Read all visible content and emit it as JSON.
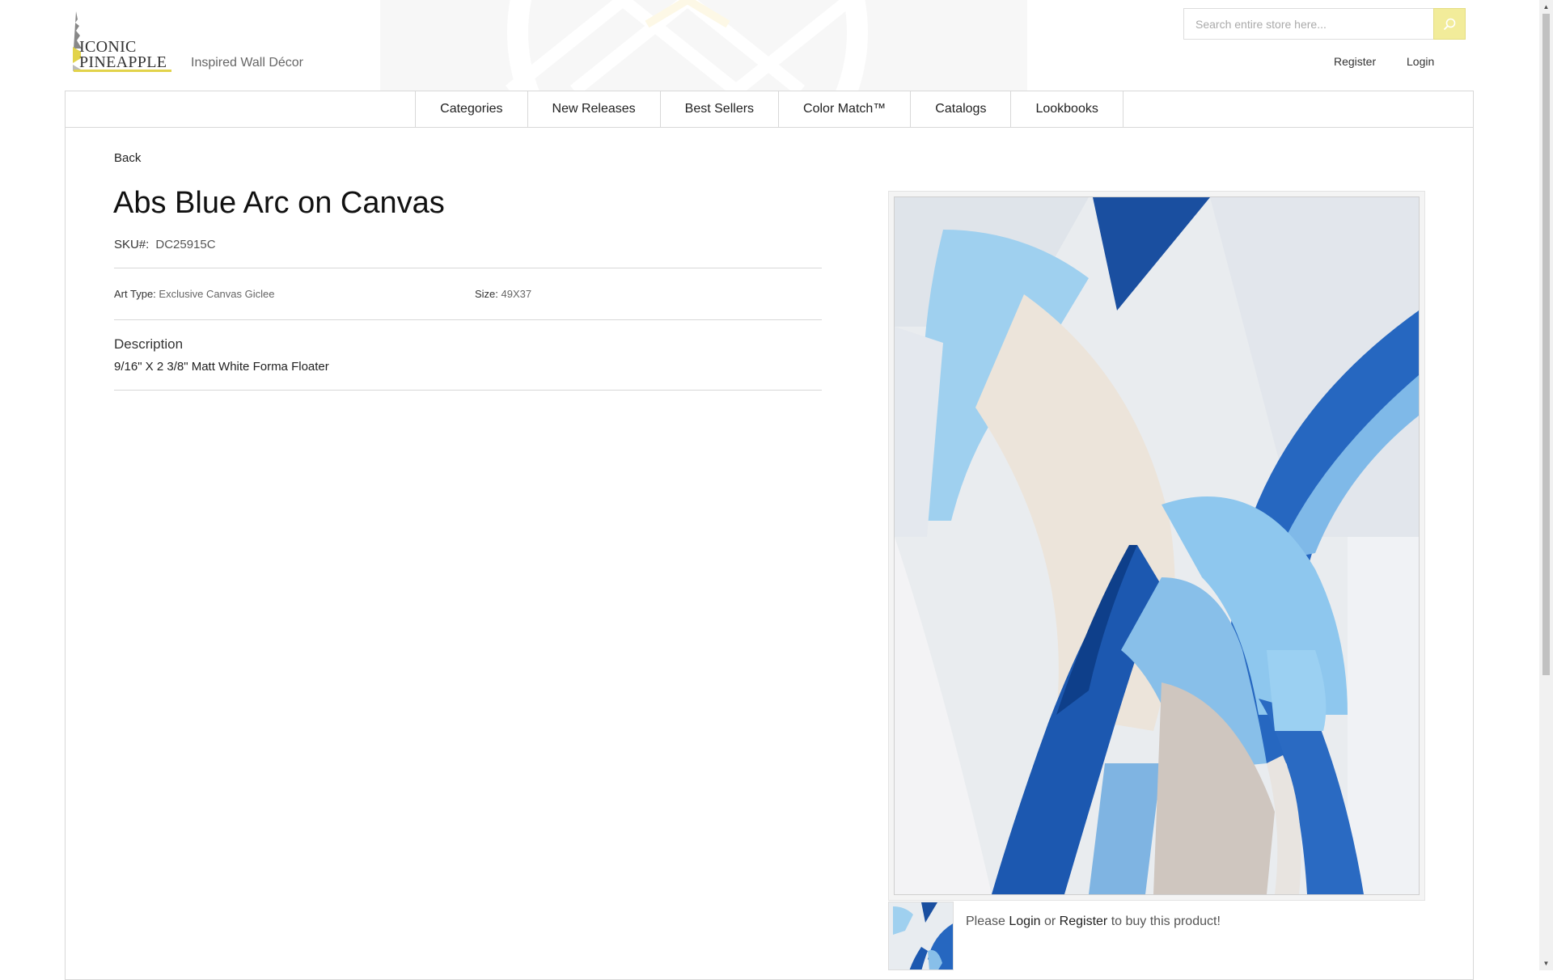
{
  "header": {
    "logo_line1": "ICONIC",
    "logo_line2": "PINEAPPLE",
    "tagline": "Inspired Wall Décor",
    "search": {
      "placeholder": "Search entire store here...",
      "value": ""
    },
    "account": {
      "register": "Register",
      "login": "Login"
    }
  },
  "nav": {
    "items": [
      {
        "label": "Categories"
      },
      {
        "label": "New Releases"
      },
      {
        "label": "Best Sellers"
      },
      {
        "label": "Color Match™"
      },
      {
        "label": "Catalogs"
      },
      {
        "label": "Lookbooks"
      }
    ]
  },
  "product": {
    "back_label": "Back",
    "title": "Abs Blue Arc on Canvas",
    "sku_label": "SKU#:",
    "sku": "DC25915C",
    "art_type_label": "Art Type:",
    "art_type": "Exclusive Canvas Giclee",
    "size_label": "Size:",
    "size": "49X37",
    "description_heading": "Description",
    "description": "9/16\" X 2 3/8\" Matt White Forma Floater"
  },
  "purchase": {
    "prefix": "Please",
    "login": "Login",
    "or": "or",
    "register": "Register",
    "suffix": "to buy this product!"
  },
  "colors": {
    "accent_yellow": "#f2ec9a",
    "logo_bar": "#e2d34a",
    "border": "#d8d8d8",
    "art_blue_dark": "#1a52a8",
    "art_blue_light": "#8cc4ea"
  }
}
